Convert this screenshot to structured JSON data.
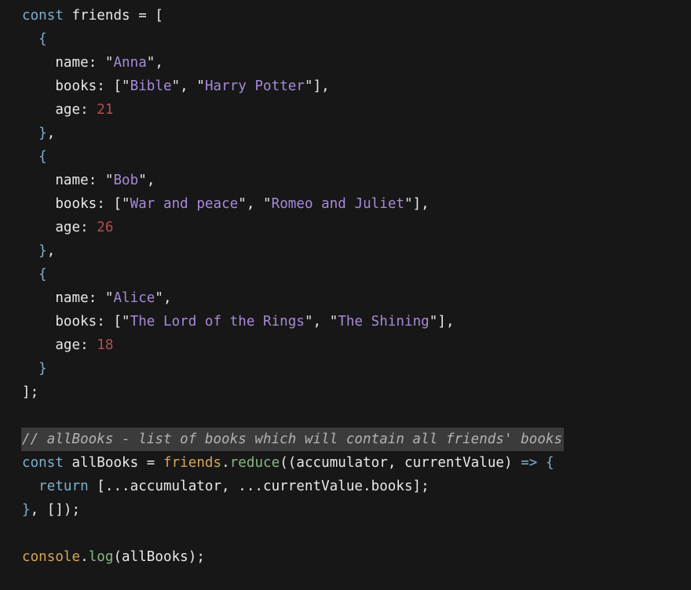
{
  "editor": {
    "language": "javascript",
    "background_color": "#171717",
    "highlight_band_color": "#3b3b3b",
    "default_text_color": "#e9e9e9",
    "palette": {
      "keyword": "#7fb0cb",
      "string": "#a78bda",
      "quote": "#e2e2e2",
      "number": "#b0504e",
      "object": "#d8a657",
      "function": "#87b987",
      "comment": "#b3b3b3",
      "brace": "#7fb0cb"
    }
  },
  "code": {
    "lines": [
      {
        "indent": 0,
        "tokens": [
          {
            "t": "const",
            "c": "kw"
          },
          {
            "t": " ",
            "c": "plain"
          },
          {
            "t": "friends",
            "c": "plain"
          },
          {
            "t": " = ",
            "c": "plain"
          },
          {
            "t": "[",
            "c": "plain"
          }
        ]
      },
      {
        "indent": 0,
        "tokens": [
          {
            "t": "  ",
            "c": "plain"
          },
          {
            "t": "{",
            "c": "brace"
          }
        ]
      },
      {
        "indent": 0,
        "tokens": [
          {
            "t": "    name",
            "c": "prop"
          },
          {
            "t": ": ",
            "c": "plain"
          },
          {
            "t": "\"",
            "c": "quote"
          },
          {
            "t": "Anna",
            "c": "str"
          },
          {
            "t": "\"",
            "c": "quote"
          },
          {
            "t": ",",
            "c": "plain"
          }
        ]
      },
      {
        "indent": 0,
        "tokens": [
          {
            "t": "    books",
            "c": "prop"
          },
          {
            "t": ": [",
            "c": "plain"
          },
          {
            "t": "\"",
            "c": "quote"
          },
          {
            "t": "Bible",
            "c": "str"
          },
          {
            "t": "\"",
            "c": "quote"
          },
          {
            "t": ", ",
            "c": "plain"
          },
          {
            "t": "\"",
            "c": "quote"
          },
          {
            "t": "Harry Potter",
            "c": "str"
          },
          {
            "t": "\"",
            "c": "quote"
          },
          {
            "t": "],",
            "c": "plain"
          }
        ]
      },
      {
        "indent": 0,
        "tokens": [
          {
            "t": "    age",
            "c": "prop"
          },
          {
            "t": ": ",
            "c": "plain"
          },
          {
            "t": "21",
            "c": "num"
          }
        ]
      },
      {
        "indent": 0,
        "tokens": [
          {
            "t": "  ",
            "c": "plain"
          },
          {
            "t": "}",
            "c": "brace"
          },
          {
            "t": ",",
            "c": "plain"
          }
        ]
      },
      {
        "indent": 0,
        "tokens": [
          {
            "t": "  ",
            "c": "plain"
          },
          {
            "t": "{",
            "c": "brace"
          }
        ]
      },
      {
        "indent": 0,
        "tokens": [
          {
            "t": "    name",
            "c": "prop"
          },
          {
            "t": ": ",
            "c": "plain"
          },
          {
            "t": "\"",
            "c": "quote"
          },
          {
            "t": "Bob",
            "c": "str"
          },
          {
            "t": "\"",
            "c": "quote"
          },
          {
            "t": ",",
            "c": "plain"
          }
        ]
      },
      {
        "indent": 0,
        "tokens": [
          {
            "t": "    books",
            "c": "prop"
          },
          {
            "t": ": [",
            "c": "plain"
          },
          {
            "t": "\"",
            "c": "quote"
          },
          {
            "t": "War and peace",
            "c": "str"
          },
          {
            "t": "\"",
            "c": "quote"
          },
          {
            "t": ", ",
            "c": "plain"
          },
          {
            "t": "\"",
            "c": "quote"
          },
          {
            "t": "Romeo and Juliet",
            "c": "str"
          },
          {
            "t": "\"",
            "c": "quote"
          },
          {
            "t": "],",
            "c": "plain"
          }
        ]
      },
      {
        "indent": 0,
        "tokens": [
          {
            "t": "    age",
            "c": "prop"
          },
          {
            "t": ": ",
            "c": "plain"
          },
          {
            "t": "26",
            "c": "num"
          }
        ]
      },
      {
        "indent": 0,
        "tokens": [
          {
            "t": "  ",
            "c": "plain"
          },
          {
            "t": "}",
            "c": "brace"
          },
          {
            "t": ",",
            "c": "plain"
          }
        ]
      },
      {
        "indent": 0,
        "tokens": [
          {
            "t": "  ",
            "c": "plain"
          },
          {
            "t": "{",
            "c": "brace"
          }
        ]
      },
      {
        "indent": 0,
        "tokens": [
          {
            "t": "    name",
            "c": "prop"
          },
          {
            "t": ": ",
            "c": "plain"
          },
          {
            "t": "\"",
            "c": "quote"
          },
          {
            "t": "Alice",
            "c": "str"
          },
          {
            "t": "\"",
            "c": "quote"
          },
          {
            "t": ",",
            "c": "plain"
          }
        ]
      },
      {
        "indent": 0,
        "tokens": [
          {
            "t": "    books",
            "c": "prop"
          },
          {
            "t": ": [",
            "c": "plain"
          },
          {
            "t": "\"",
            "c": "quote"
          },
          {
            "t": "The Lord of the Rings",
            "c": "str"
          },
          {
            "t": "\"",
            "c": "quote"
          },
          {
            "t": ", ",
            "c": "plain"
          },
          {
            "t": "\"",
            "c": "quote"
          },
          {
            "t": "The Shining",
            "c": "str"
          },
          {
            "t": "\"",
            "c": "quote"
          },
          {
            "t": "],",
            "c": "plain"
          }
        ]
      },
      {
        "indent": 0,
        "tokens": [
          {
            "t": "    age",
            "c": "prop"
          },
          {
            "t": ": ",
            "c": "plain"
          },
          {
            "t": "18",
            "c": "num"
          }
        ]
      },
      {
        "indent": 0,
        "tokens": [
          {
            "t": "  ",
            "c": "plain"
          },
          {
            "t": "}",
            "c": "brace"
          }
        ]
      },
      {
        "indent": 0,
        "tokens": [
          {
            "t": "];",
            "c": "plain"
          }
        ]
      },
      {
        "indent": 0,
        "tokens": []
      },
      {
        "indent": 0,
        "highlighted": true,
        "tokens": [
          {
            "t": "// allBooks - list of books which will contain all friends' books",
            "c": "comment"
          }
        ]
      },
      {
        "indent": 0,
        "tokens": [
          {
            "t": "const",
            "c": "kw"
          },
          {
            "t": " ",
            "c": "plain"
          },
          {
            "t": "allBooks",
            "c": "plain"
          },
          {
            "t": " = ",
            "c": "plain"
          },
          {
            "t": "friends",
            "c": "obj"
          },
          {
            "t": ".",
            "c": "plain"
          },
          {
            "t": "reduce",
            "c": "fn"
          },
          {
            "t": "((accumulator, currentValue) ",
            "c": "plain"
          },
          {
            "t": "=>",
            "c": "brace"
          },
          {
            "t": " ",
            "c": "plain"
          },
          {
            "t": "{",
            "c": "brace"
          }
        ]
      },
      {
        "indent": 0,
        "tokens": [
          {
            "t": "  ",
            "c": "plain"
          },
          {
            "t": "return",
            "c": "kw"
          },
          {
            "t": " [...accumulator, ...currentValue.books];",
            "c": "plain"
          }
        ]
      },
      {
        "indent": 0,
        "tokens": [
          {
            "t": "}",
            "c": "brace"
          },
          {
            "t": ", []);",
            "c": "plain"
          }
        ]
      },
      {
        "indent": 0,
        "tokens": []
      },
      {
        "indent": 0,
        "tokens": [
          {
            "t": "console",
            "c": "obj"
          },
          {
            "t": ".",
            "c": "plain"
          },
          {
            "t": "log",
            "c": "fn"
          },
          {
            "t": "(allBooks);",
            "c": "plain"
          }
        ]
      }
    ]
  }
}
